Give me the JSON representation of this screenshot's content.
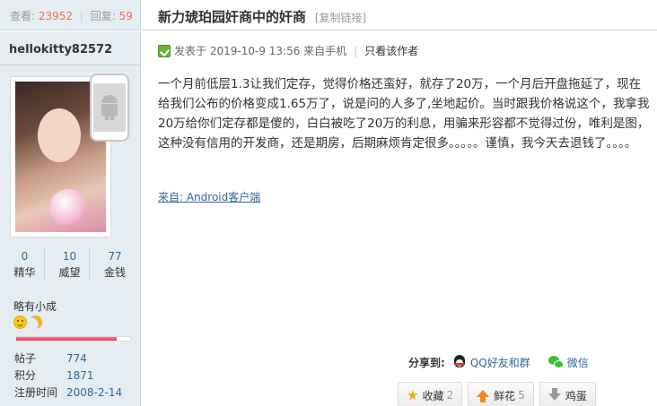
{
  "thread": {
    "views_label": "查看:",
    "views": "23952",
    "separator": "|",
    "replies_label": "回复:",
    "replies": "59",
    "title": "新力琥珀园奸商中的奸商",
    "copy_link": "[复制链接]"
  },
  "author": {
    "username": "hellokitty82572",
    "stats": [
      {
        "value": "0",
        "label": "精华"
      },
      {
        "value": "10",
        "label": "威望"
      },
      {
        "value": "77",
        "label": "金钱"
      }
    ],
    "rank": "略有小成",
    "level_progress": 0.88,
    "info": [
      {
        "key": "帖子",
        "value": "774"
      },
      {
        "key": "积分",
        "value": "1871"
      },
      {
        "key": "注册时间",
        "value": "2008-2-14"
      }
    ]
  },
  "post": {
    "posted_prefix": "发表于",
    "posted_at": "2019-10-9 13:56",
    "posted_source": "来自手机",
    "meta_sep": "|",
    "author_only": "只看该作者",
    "body": "一个月前低层1.3让我们定存，觉得价格还蛮好，就存了20万，一个月后开盘拖延了，现在给我们公布的价格变成1.65万了，说是问的人多了,坐地起价。当时跟我价格说这个，我拿我20万给你们定存都是傻的，白白被吃了20万的利息，用骗来形容都不觉得过份，唯利是图，这种没有信用的开发商，还是期房，后期麻烦肯定很多。。。。。谨慎，我今天去退钱了。。。。",
    "from_client": "来自: Android客户端"
  },
  "share": {
    "label": "分享到:",
    "qq": "QQ好友和群",
    "wechat": "微信"
  },
  "actions": {
    "favorite_label": "收藏",
    "favorite_count": "2",
    "flower_label": "鲜花",
    "flower_count": "5",
    "egg_label": "鸡蛋"
  },
  "colors": {
    "sidebar_bg": "#e5edf2",
    "border": "#c2d5e3",
    "link": "#336699",
    "count": "#f26c4f"
  },
  "icons": [
    "android-icon",
    "smiley-icon",
    "moon-icon",
    "online-icon",
    "qq-icon",
    "wechat-icon",
    "star-icon",
    "thumb-up-icon",
    "thumb-down-icon"
  ]
}
